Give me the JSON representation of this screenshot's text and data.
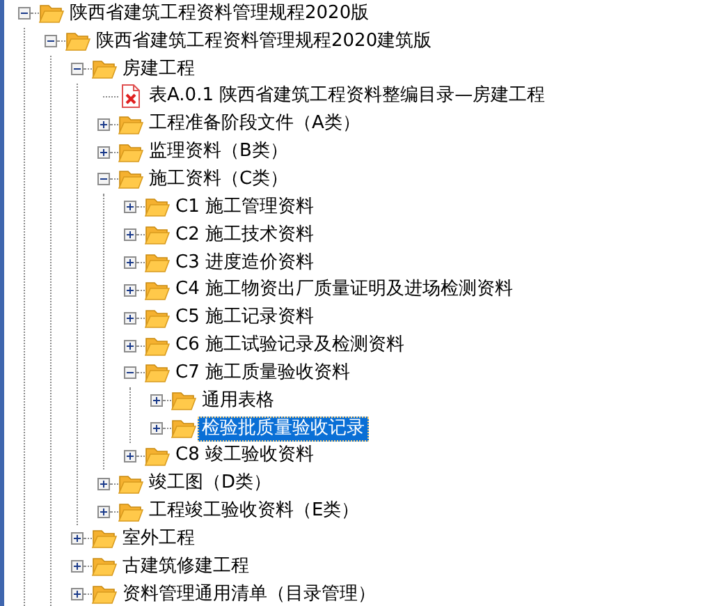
{
  "tree": [
    {
      "label": "陕西省建筑工程资料管理规程2020版",
      "kind": "folder",
      "expanded": true,
      "selected": false,
      "children": [
        {
          "label": "陕西省建筑工程资料管理规程2020建筑版",
          "kind": "folder",
          "expanded": true,
          "selected": false,
          "children": [
            {
              "label": "房建工程",
              "kind": "folder",
              "expanded": true,
              "selected": false,
              "children": [
                {
                  "label": "表A.0.1 陕西省建筑工程资料整编目录—房建工程",
                  "kind": "file",
                  "selected": false
                },
                {
                  "label": "工程准备阶段文件（A类）",
                  "kind": "folder",
                  "expanded": false,
                  "selected": false
                },
                {
                  "label": "监理资料（B类）",
                  "kind": "folder",
                  "expanded": false,
                  "selected": false
                },
                {
                  "label": "施工资料（C类）",
                  "kind": "folder",
                  "expanded": true,
                  "selected": false,
                  "children": [
                    {
                      "label": "C1 施工管理资料",
                      "kind": "folder",
                      "expanded": false,
                      "selected": false
                    },
                    {
                      "label": "C2 施工技术资料",
                      "kind": "folder",
                      "expanded": false,
                      "selected": false
                    },
                    {
                      "label": "C3 进度造价资料",
                      "kind": "folder",
                      "expanded": false,
                      "selected": false
                    },
                    {
                      "label": "C4 施工物资出厂质量证明及进场检测资料",
                      "kind": "folder",
                      "expanded": false,
                      "selected": false
                    },
                    {
                      "label": "C5 施工记录资料",
                      "kind": "folder",
                      "expanded": false,
                      "selected": false
                    },
                    {
                      "label": "C6 施工试验记录及检测资料",
                      "kind": "folder",
                      "expanded": false,
                      "selected": false
                    },
                    {
                      "label": "C7 施工质量验收资料",
                      "kind": "folder",
                      "expanded": true,
                      "selected": false,
                      "children": [
                        {
                          "label": "通用表格",
                          "kind": "folder",
                          "expanded": false,
                          "selected": false
                        },
                        {
                          "label": "检验批质量验收记录",
                          "kind": "folder",
                          "expanded": false,
                          "selected": true
                        }
                      ]
                    },
                    {
                      "label": "C8 竣工验收资料",
                      "kind": "folder",
                      "expanded": false,
                      "selected": false
                    }
                  ]
                },
                {
                  "label": "竣工图（D类）",
                  "kind": "folder",
                  "expanded": false,
                  "selected": false
                },
                {
                  "label": "工程竣工验收资料（E类）",
                  "kind": "folder",
                  "expanded": false,
                  "selected": false
                }
              ]
            },
            {
              "label": "室外工程",
              "kind": "folder",
              "expanded": false,
              "selected": false
            },
            {
              "label": "古建筑修建工程",
              "kind": "folder",
              "expanded": false,
              "selected": false
            },
            {
              "label": "资料管理通用清单（目录管理）",
              "kind": "folder",
              "expanded": false,
              "selected": false
            }
          ]
        }
      ]
    }
  ]
}
